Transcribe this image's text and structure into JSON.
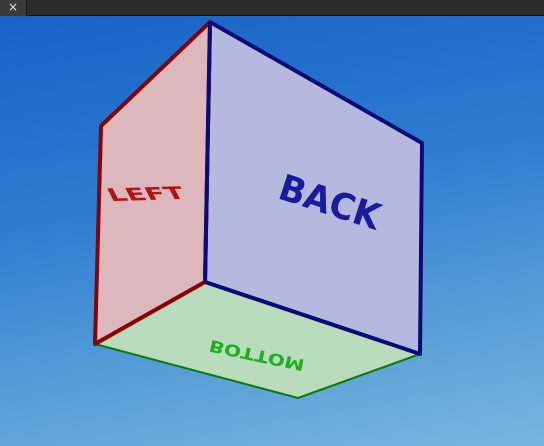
{
  "window": {
    "close_glyph": "×"
  },
  "scene": {
    "background_top": "#1762c7",
    "background_bottom": "#78b6e0",
    "faces": {
      "left": {
        "label": "LEFT",
        "fill": "#dcb7bb",
        "edge": "#8b0000",
        "text_color": "#b01414"
      },
      "back": {
        "label": "BACK",
        "fill": "#b6b9de",
        "edge": "#0a0a7a",
        "text_color": "#1a1aa0"
      },
      "bottom": {
        "label": "BOTTOM",
        "fill": "#b9dcbc",
        "edge": "#0b7a0b",
        "text_color": "#1fae1f"
      }
    }
  }
}
